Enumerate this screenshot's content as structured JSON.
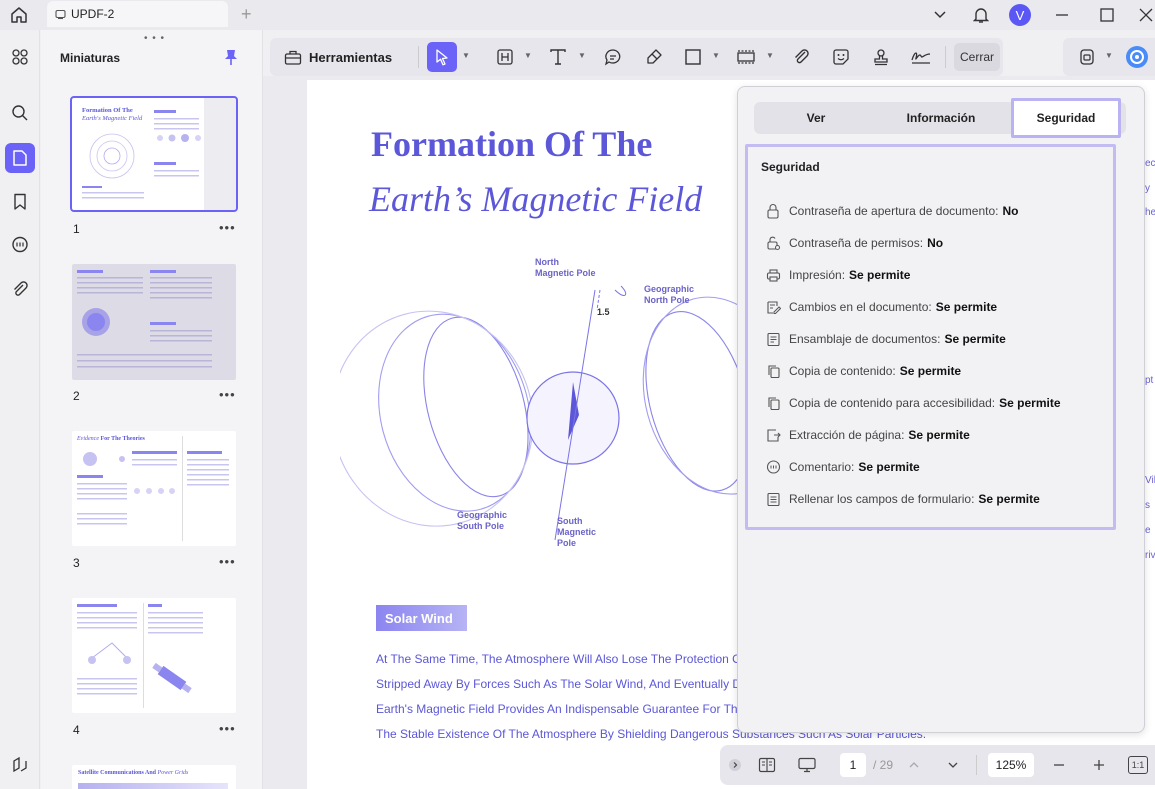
{
  "window": {
    "tab_title": "UPDF-2",
    "tab_add": "+",
    "avatar_letter": "V",
    "accent": "#6b63f7"
  },
  "sidebar": {
    "title": "Miniaturas",
    "grip": "• • •",
    "thumbnails": [
      {
        "num": "1",
        "more": "•••",
        "title_a": "Formation Of The",
        "title_b": "Earth's Magnetic Field"
      },
      {
        "num": "2",
        "more": "•••"
      },
      {
        "num": "3",
        "more": "•••",
        "title_a": "Evidence",
        "title_b": "For The Theories"
      },
      {
        "num": "4",
        "more": "•••"
      },
      {
        "title_a": "Satellite Communications And",
        "title_b": "Power Grids"
      }
    ]
  },
  "toolbar": {
    "tools_label": "Herramientas",
    "close_label": "Cerrar"
  },
  "document": {
    "title_line1": "Formation Of The",
    "title_line2": "Earth’s Magnetic Field",
    "figure": {
      "north_magnetic": [
        "North",
        "Magnetic Pole"
      ],
      "geographic_north": [
        "Geographic",
        "North Pole"
      ],
      "angle": "1.5",
      "geographic_south": [
        "Geographic",
        "South Pole"
      ],
      "south_magnetic": [
        "South",
        "Magnetic",
        "Pole"
      ]
    },
    "section_label": "Solar Wind",
    "paragraph": [
      "At The Same Time, The Atmosphere Will Also Lose The Protection Of",
      "Stripped Away By Forces Such As The Solar Wind, And Eventually Di",
      "Earth's Magnetic Field Provides An Indispensable Guarantee For The",
      "The Stable Existence Of The Atmosphere By Shielding Dangerous Substances Such As Solar Particles."
    ],
    "edge_fragments": [
      "ec",
      "y",
      "he",
      "pt",
      "Vil",
      "s",
      "e",
      "riv"
    ]
  },
  "properties": {
    "tabs": [
      "Ver",
      "Información",
      "Seguridad"
    ],
    "active_tab": "Seguridad",
    "section_title": "Seguridad",
    "items": [
      {
        "icon": "lock-icon",
        "label": "Contraseña de apertura de documento:",
        "value": "No"
      },
      {
        "icon": "key-lock-icon",
        "label": "Contraseña de permisos:",
        "value": "No"
      },
      {
        "icon": "printer-icon",
        "label": "Impresión:",
        "value": "Se permite"
      },
      {
        "icon": "edit-doc-icon",
        "label": "Cambios en el documento:",
        "value": "Se permite"
      },
      {
        "icon": "assemble-icon",
        "label": "Ensamblaje de documentos:",
        "value": "Se permite"
      },
      {
        "icon": "copy-icon",
        "label": "Copia de contenido:",
        "value": "Se permite"
      },
      {
        "icon": "copy-access-icon",
        "label": "Copia de contenido para accesibilidad:",
        "value": "Se permite"
      },
      {
        "icon": "extract-page-icon",
        "label": "Extracción de página:",
        "value": "Se permite"
      },
      {
        "icon": "comment-icon",
        "label": "Comentario:",
        "value": "Se permite"
      },
      {
        "icon": "form-icon",
        "label": "Rellenar los campos de formulario:",
        "value": "Se permite"
      }
    ]
  },
  "bottom": {
    "current_page": "1",
    "total_pages": "/ 29",
    "zoom": "125%",
    "fit_label": "1:1"
  }
}
